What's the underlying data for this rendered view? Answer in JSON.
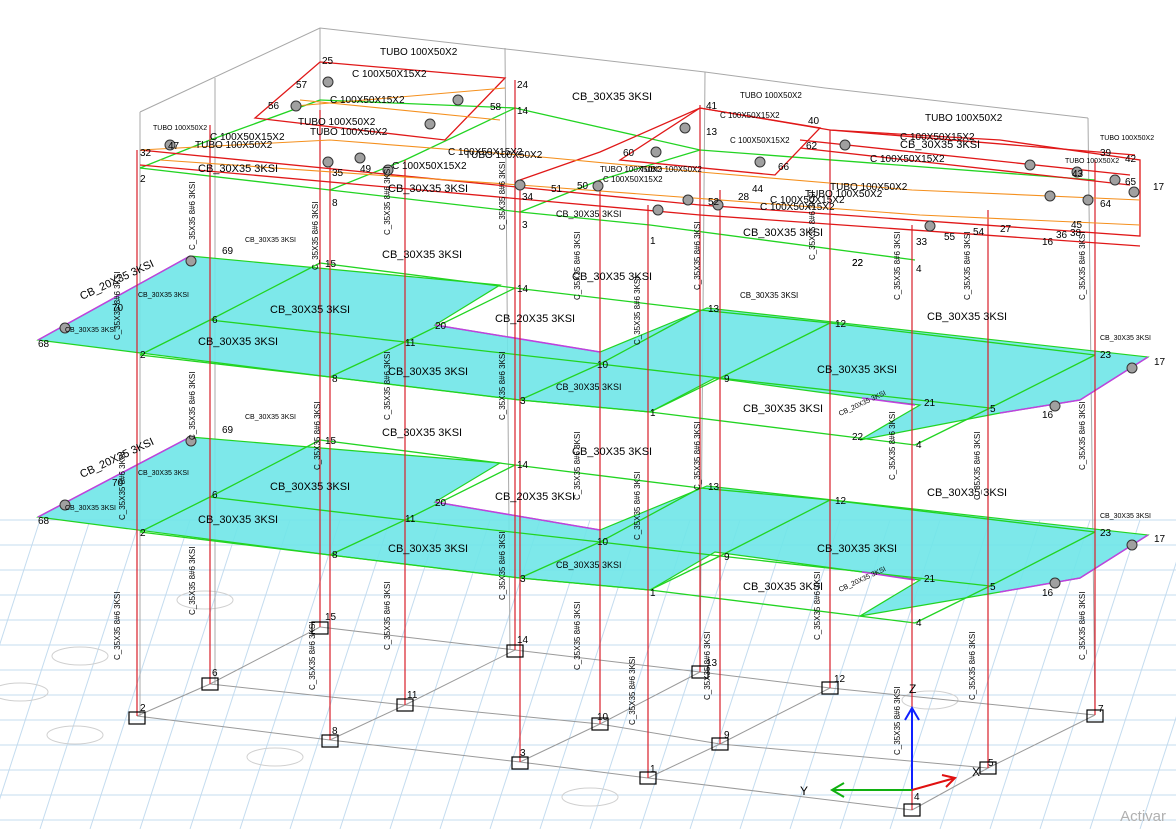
{
  "view": {
    "axis_labels": {
      "x": "X",
      "y": "Y",
      "z": "Z"
    },
    "watermark": "Activar",
    "colors": {
      "slab": "#6fe5e8",
      "beam_green": "#22d422",
      "column_red": "#d81f2a",
      "roof_red": "#e01818",
      "roof_orange": "#f5901e",
      "edge_magenta": "#c040e0",
      "grid_blue": "#c4dcef",
      "base_gray": "#9a9a9a",
      "axis_blue": "#1020ff",
      "axis_green": "#10b010",
      "axis_red": "#e01010"
    }
  },
  "sections": {
    "roof_tubo": "TUBO 100X50X2",
    "roof_c": "C 100X50X15X2",
    "beam": "CB_30X35 3KSI",
    "beam_small": "CB_20X35 3KSI",
    "column": "C_35X35 8#6 3KSI"
  },
  "joints": {
    "base": [
      {
        "id": "2"
      },
      {
        "id": "6"
      },
      {
        "id": "15"
      },
      {
        "id": "8"
      },
      {
        "id": "11"
      },
      {
        "id": "14"
      },
      {
        "id": "3"
      },
      {
        "id": "10"
      },
      {
        "id": "13"
      },
      {
        "id": "1"
      },
      {
        "id": "9"
      },
      {
        "id": "12"
      },
      {
        "id": "4"
      },
      {
        "id": "5"
      },
      {
        "id": "7"
      }
    ],
    "floor": [
      {
        "id": "68"
      },
      {
        "id": "70"
      },
      {
        "id": "69"
      },
      {
        "id": "2"
      },
      {
        "id": "6"
      },
      {
        "id": "15"
      },
      {
        "id": "8"
      },
      {
        "id": "11"
      },
      {
        "id": "20"
      },
      {
        "id": "14"
      },
      {
        "id": "3"
      },
      {
        "id": "10"
      },
      {
        "id": "13"
      },
      {
        "id": "1"
      },
      {
        "id": "9"
      },
      {
        "id": "12"
      },
      {
        "id": "22"
      },
      {
        "id": "21"
      },
      {
        "id": "4"
      },
      {
        "id": "5"
      },
      {
        "id": "16"
      },
      {
        "id": "23"
      },
      {
        "id": "17"
      }
    ],
    "roof": [
      {
        "id": "25"
      },
      {
        "id": "24"
      },
      {
        "id": "57"
      },
      {
        "id": "56"
      },
      {
        "id": "58"
      },
      {
        "id": "14"
      },
      {
        "id": "32"
      },
      {
        "id": "47"
      },
      {
        "id": "2"
      },
      {
        "id": "35"
      },
      {
        "id": "49"
      },
      {
        "id": "8"
      },
      {
        "id": "34"
      },
      {
        "id": "51"
      },
      {
        "id": "50"
      },
      {
        "id": "3"
      },
      {
        "id": "41"
      },
      {
        "id": "13"
      },
      {
        "id": "60"
      },
      {
        "id": "66"
      },
      {
        "id": "40"
      },
      {
        "id": "62"
      },
      {
        "id": "44"
      },
      {
        "id": "28"
      },
      {
        "id": "52"
      },
      {
        "id": "1"
      },
      {
        "id": "22"
      },
      {
        "id": "33"
      },
      {
        "id": "55"
      },
      {
        "id": "4"
      },
      {
        "id": "54"
      },
      {
        "id": "27"
      },
      {
        "id": "16"
      },
      {
        "id": "36"
      },
      {
        "id": "38"
      },
      {
        "id": "45"
      },
      {
        "id": "39"
      },
      {
        "id": "42"
      },
      {
        "id": "43"
      },
      {
        "id": "65"
      },
      {
        "id": "17"
      },
      {
        "id": "64"
      }
    ]
  }
}
